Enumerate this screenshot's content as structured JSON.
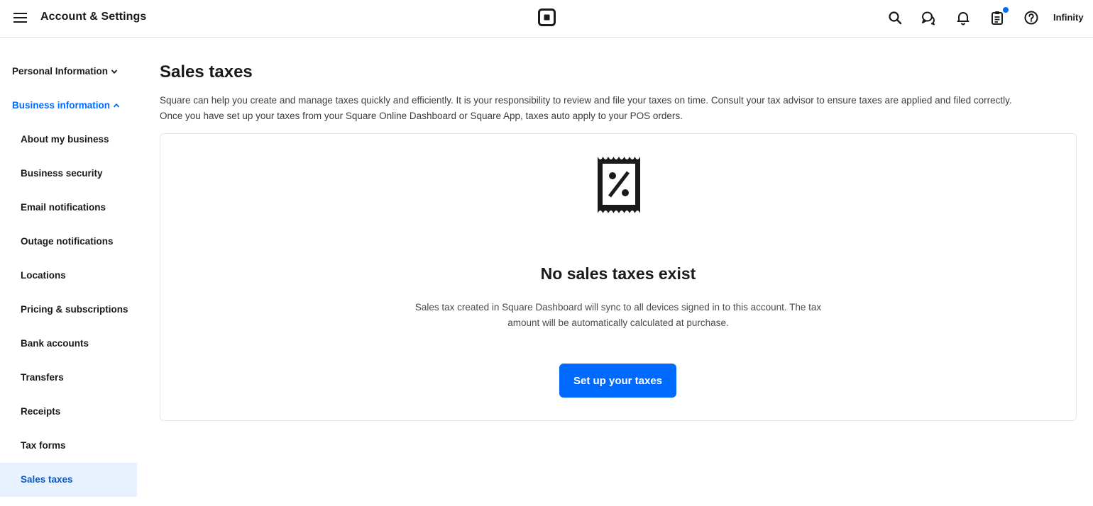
{
  "header": {
    "title": "Account & Settings",
    "account_name": "Infinity",
    "icons": [
      "menu-icon",
      "square-logo-icon",
      "search-icon",
      "messages-icon",
      "bell-icon",
      "clipboard-icon",
      "help-icon"
    ],
    "notification_dot_color": "#006aff"
  },
  "sidebar": {
    "groups": [
      {
        "label": "Personal Information",
        "expanded": false
      },
      {
        "label": "Business information",
        "expanded": true
      }
    ],
    "items": [
      {
        "label": "About my business"
      },
      {
        "label": "Business security"
      },
      {
        "label": "Email notifications"
      },
      {
        "label": "Outage notifications"
      },
      {
        "label": "Locations"
      },
      {
        "label": "Pricing & subscriptions"
      },
      {
        "label": "Bank accounts"
      },
      {
        "label": "Transfers"
      },
      {
        "label": "Receipts"
      },
      {
        "label": "Tax forms"
      },
      {
        "label": "Sales taxes",
        "active": true
      }
    ]
  },
  "main": {
    "title": "Sales taxes",
    "description_line1": "Square can help you create and manage taxes quickly and efficiently. It is your responsibility to review and file your taxes on time. Consult your tax advisor to ensure taxes are applied and filed correctly.",
    "description_line2": "Once you have set up your taxes from your Square Online Dashboard or Square App, taxes auto apply to your POS orders.",
    "empty_state": {
      "icon": "tax-receipt-icon",
      "title": "No sales taxes exist",
      "description": "Sales tax created in Square Dashboard will sync to all devices signed in to this account. The tax amount will be automatically calculated at purchase.",
      "button_label": "Set up your taxes"
    }
  },
  "colors": {
    "accent": "#006aff",
    "active_bg": "#e8f1fe",
    "active_text": "#0c5ac2"
  }
}
